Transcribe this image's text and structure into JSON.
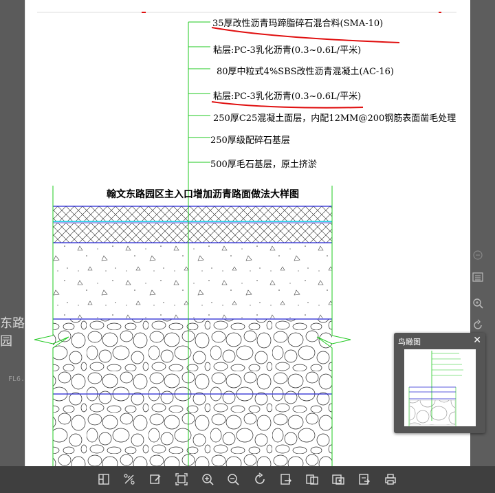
{
  "drawing": {
    "labels": [
      "35厚改性沥青玛蹄脂碎石混合料(SMA-10)",
      "粘层:PC-3乳化沥青(0.3~0.6L/平米)",
      "80厚中粒式4%SBS改性沥青混凝土(AC-16)",
      "粘层:PC-3乳化沥青(0.3~0.6L/平米)",
      "250厚C25混凝土面层，内配12MM@200钢筋表面凿毛处理",
      "250厚级配碎石基层",
      "500厚毛石基层，原土挤淤"
    ],
    "title": "翰文东路园区主入口增加沥青路面做法大样图"
  },
  "background": {
    "cad_text": "东路园",
    "cad_small": "FL6."
  },
  "overview": {
    "title": "鸟瞰图",
    "close": "✕"
  },
  "toolbar": {
    "buttons": [
      "layout-icon",
      "measure-icon",
      "annotate-icon",
      "fit-screen-icon",
      "zoom-in-icon",
      "zoom-out-icon",
      "rotate-icon",
      "export-image-icon",
      "compare-icon",
      "layer-icon",
      "share-icon",
      "print-icon"
    ]
  },
  "colors": {
    "leader_green": "#1ec81e",
    "layer_blue": "#2020d0",
    "layer_cyan": "#00c8e6",
    "markup_red": "#e01010"
  }
}
